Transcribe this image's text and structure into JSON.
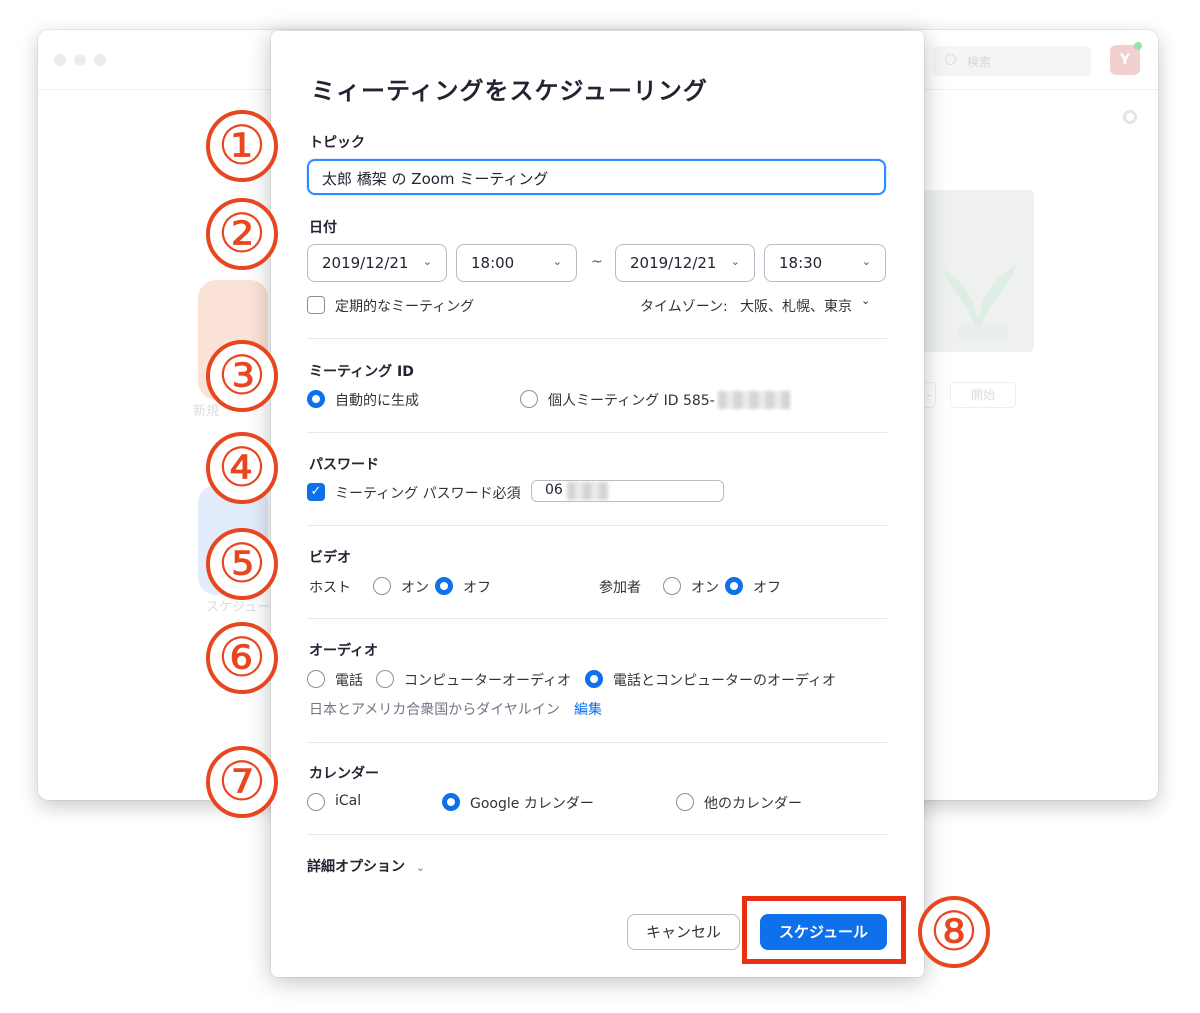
{
  "background_window": {
    "search_placeholder": "検索",
    "avatar_letter": "Y",
    "label_new": "新規",
    "label_schedule": "スケジュー",
    "btn_start": "開始",
    "btn_minus": "-"
  },
  "dialog": {
    "title": "ミィーティングをスケジューリング",
    "topic": {
      "label": "トピック",
      "value": "太郎 橋架 の Zoom ミーティング"
    },
    "date": {
      "label": "日付",
      "start_date": "2019/12/21",
      "start_time": "18:00",
      "separator": "~",
      "end_date": "2019/12/21",
      "end_time": "18:30",
      "recurring_label": "定期的なミーティング",
      "recurring_checked": false,
      "timezone_label": "タイムゾーン:",
      "timezone_value": "大阪、札幌、東京"
    },
    "meeting_id": {
      "label": "ミーティング ID",
      "auto_label": "自動的に生成",
      "personal_label": "個人ミーティング ID 585-",
      "selected": "auto"
    },
    "password": {
      "label": "パスワード",
      "require_label": "ミーティング パスワード必須",
      "checked": true,
      "value": "06"
    },
    "video": {
      "label": "ビデオ",
      "host_label": "ホスト",
      "participant_label": "参加者",
      "on_label": "オン",
      "off_label": "オフ",
      "host_selected": "off",
      "participant_selected": "off"
    },
    "audio": {
      "label": "オーディオ",
      "opt_phone": "電話",
      "opt_computer": "コンピューターオーディオ",
      "opt_both": "電話とコンピューターのオーディオ",
      "selected": "both",
      "dial_in_text": "日本とアメリカ合衆国からダイヤルイン",
      "edit_link": "編集"
    },
    "calendar": {
      "label": "カレンダー",
      "opt_ical": "iCal",
      "opt_google": "Google カレンダー",
      "opt_other": "他のカレンダー",
      "selected": "google"
    },
    "advanced": {
      "label": "詳細オプション"
    },
    "buttons": {
      "cancel": "キャンセル",
      "schedule": "スケジュール"
    }
  },
  "annotations": [
    "①",
    "②",
    "③",
    "④",
    "⑤",
    "⑥",
    "⑦",
    "⑧"
  ],
  "colors": {
    "accent": "#0e71eb",
    "annotation_red": "#e8461e"
  }
}
